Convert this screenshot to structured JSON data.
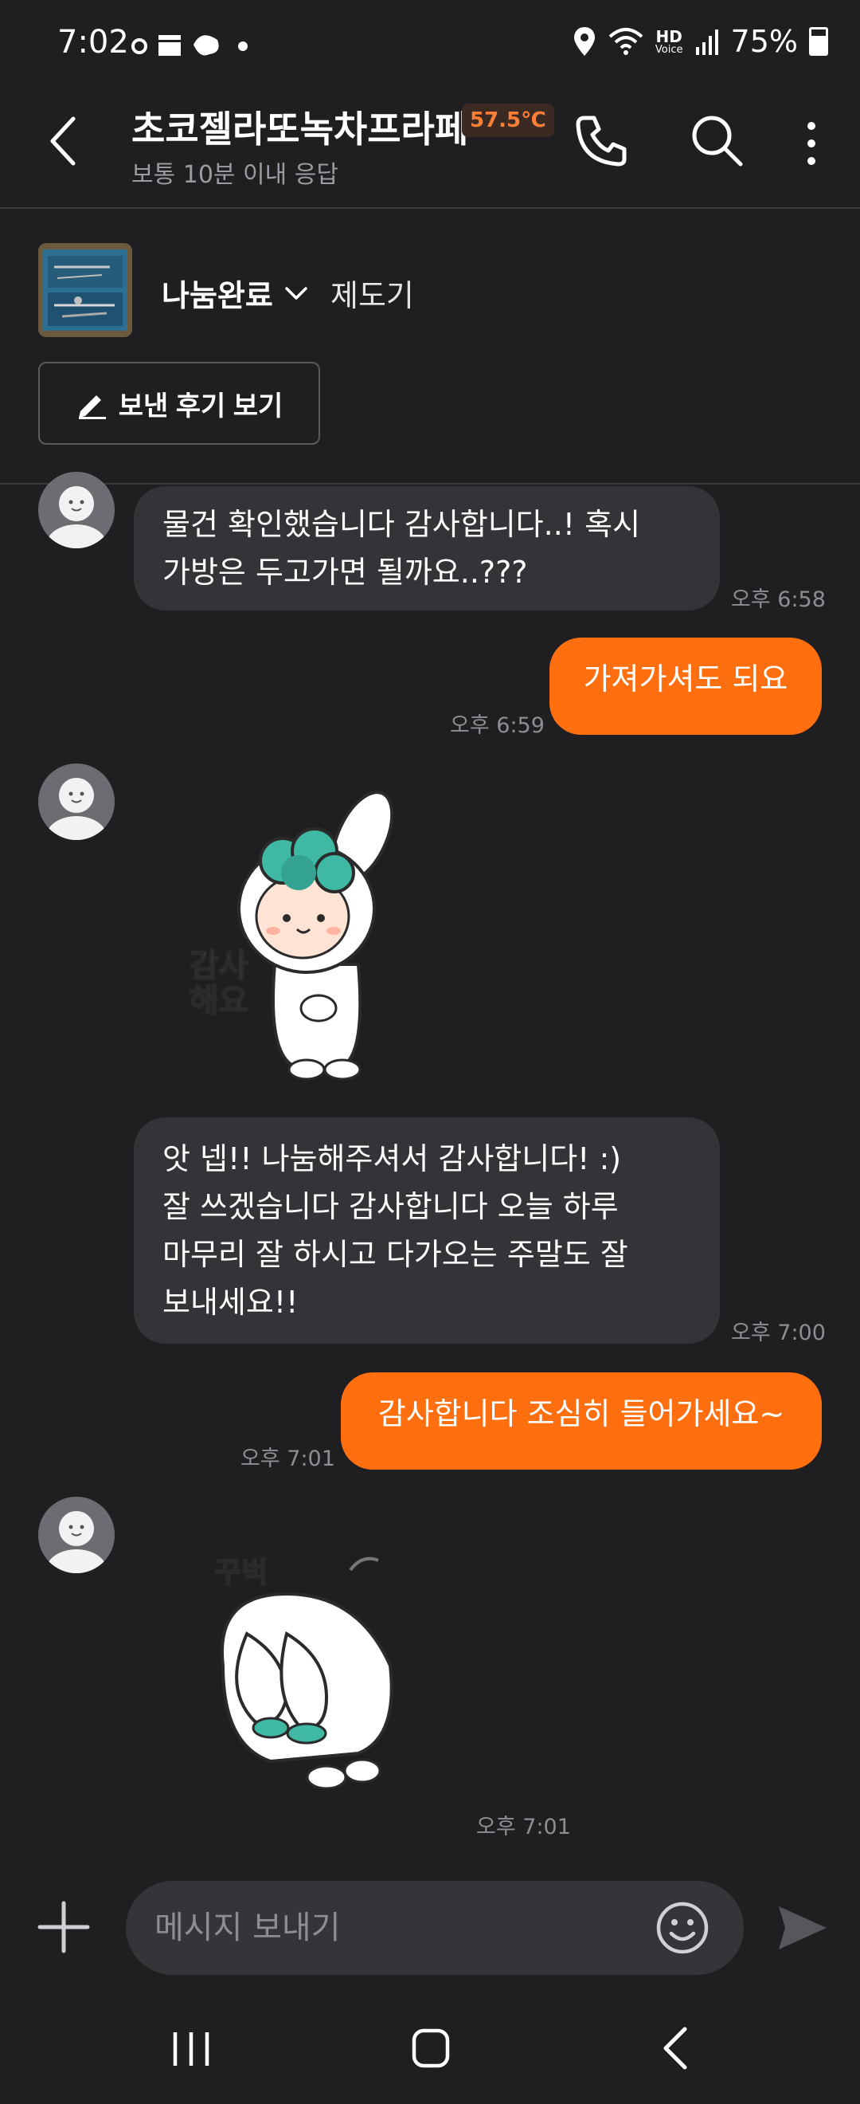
{
  "status_bar": {
    "time": "7:02",
    "hd_label": "HD",
    "voice_label": "Voice",
    "battery": "75%"
  },
  "header": {
    "title": "초코젤라또녹차프라페",
    "temperature": "57.5℃",
    "response_time": "보통 10분 이내 응답"
  },
  "product": {
    "status": "나눔완료",
    "name": "제도기",
    "review_button": "보낸 후기 보기"
  },
  "messages": [
    {
      "lines": [
        "물건 확인했습니다 감사합니다..! 혹시",
        "가방은 두고가면 될까요..???"
      ],
      "time": "오후 6:58"
    },
    {
      "lines": [
        "가져가셔도 되요"
      ],
      "time": "오후 6:59"
    },
    {
      "sticker_text": "감사\n해요"
    },
    {
      "lines": [
        "앗 넵!! 나눔해주셔서 감사합니다! :)",
        "잘 쓰겠습니다 감사합니다 오늘 하루",
        "마무리 잘 하시고 다가오는 주말도 잘",
        "보내세요!!"
      ],
      "time": "오후 7:00"
    },
    {
      "lines": [
        "감사합니다 조심히 들어가세요~"
      ],
      "time": "오후 7:01"
    },
    {
      "sticker_text": "꾸벅",
      "time": "오후 7:01"
    }
  ],
  "input": {
    "placeholder": "메시지 보내기"
  },
  "colors": {
    "background": "#1f1f21",
    "incoming_bubble": "#333438",
    "outgoing_bubble": "#ff6f0f",
    "accent_temperature": "#ff7e36",
    "sticker_green": "#3fb8a4"
  },
  "icons": [
    "back-icon",
    "phone-icon",
    "search-icon",
    "more-icon",
    "pencil-icon",
    "chevron-down-icon",
    "plus-icon",
    "emoji-icon",
    "send-icon",
    "recent-apps-icon",
    "home-icon",
    "nav-back-icon"
  ]
}
